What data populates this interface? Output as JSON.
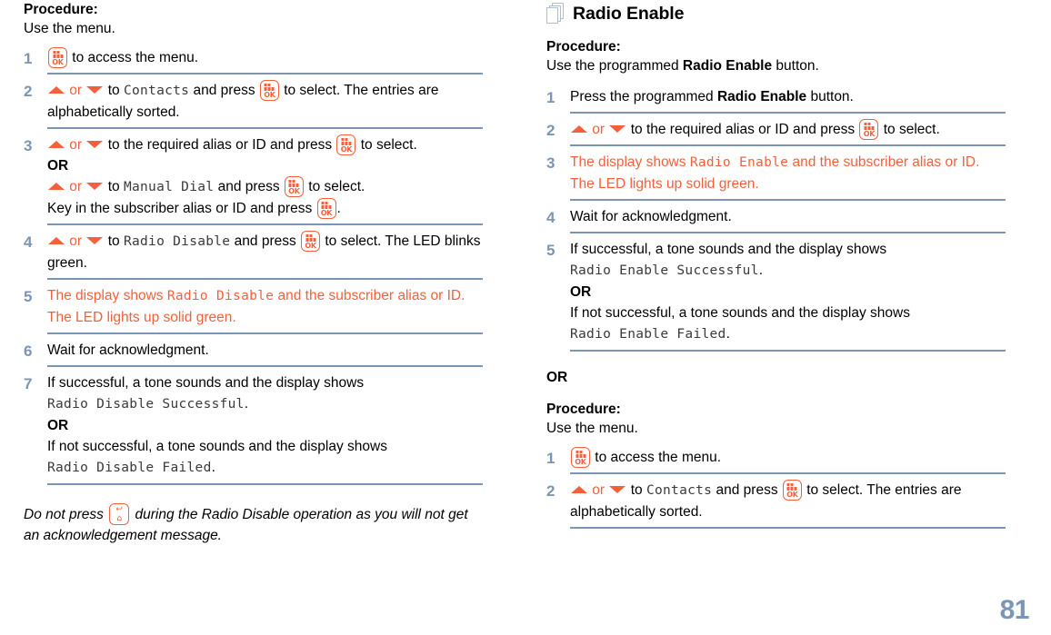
{
  "page": {
    "number": "81",
    "accent_orange": "#f4603c",
    "rule_blue": "#7b95b4",
    "number_color": "#7b95b4"
  },
  "left_column": {
    "procedure_label": "Procedure:",
    "procedure_intro": "Use the menu.",
    "steps": [
      {
        "num": "1",
        "parts": [
          {
            "type": "icon",
            "name": "menu-ok-key-icon"
          },
          {
            "type": "text",
            "value": " to access the menu."
          }
        ]
      },
      {
        "num": "2",
        "parts": [
          {
            "type": "icon",
            "name": "arrow-up-icon"
          },
          {
            "type": "orange",
            "value": " or "
          },
          {
            "type": "icon",
            "name": "arrow-down-icon"
          },
          {
            "type": "text",
            "value": " to "
          },
          {
            "type": "lcd",
            "value": "Contacts"
          },
          {
            "type": "text",
            "value": " and press "
          },
          {
            "type": "icon",
            "name": "menu-ok-key-icon"
          },
          {
            "type": "text",
            "value": " to select. The entries are alphabetically sorted."
          }
        ]
      },
      {
        "num": "3",
        "parts": [
          {
            "type": "icon",
            "name": "arrow-up-icon"
          },
          {
            "type": "orange",
            "value": " or "
          },
          {
            "type": "icon",
            "name": "arrow-down-icon"
          },
          {
            "type": "text",
            "value": " to the required alias or ID and press "
          },
          {
            "type": "icon",
            "name": "menu-ok-key-icon"
          },
          {
            "type": "text",
            "value": " to select."
          },
          {
            "type": "br"
          },
          {
            "type": "bold",
            "value": "OR"
          },
          {
            "type": "br"
          },
          {
            "type": "icon",
            "name": "arrow-up-icon"
          },
          {
            "type": "orange",
            "value": " or "
          },
          {
            "type": "icon",
            "name": "arrow-down-icon"
          },
          {
            "type": "text",
            "value": " to "
          },
          {
            "type": "lcd",
            "value": "Manual Dial"
          },
          {
            "type": "text",
            "value": " and press "
          },
          {
            "type": "icon",
            "name": "menu-ok-key-icon"
          },
          {
            "type": "text",
            "value": " to select."
          },
          {
            "type": "br"
          },
          {
            "type": "text",
            "value": "Key in the subscriber alias or ID and press "
          },
          {
            "type": "icon",
            "name": "menu-ok-key-icon"
          },
          {
            "type": "text",
            "value": "."
          }
        ]
      },
      {
        "num": "4",
        "parts": [
          {
            "type": "icon",
            "name": "arrow-up-icon"
          },
          {
            "type": "orange",
            "value": " or "
          },
          {
            "type": "icon",
            "name": "arrow-down-icon"
          },
          {
            "type": "text",
            "value": " to "
          },
          {
            "type": "lcd",
            "value": "Radio Disable"
          },
          {
            "type": "text",
            "value": " and press "
          },
          {
            "type": "icon",
            "name": "menu-ok-key-icon"
          },
          {
            "type": "text",
            "value": " to select. The LED blinks green."
          }
        ]
      },
      {
        "num": "5",
        "highlight": true,
        "parts": [
          {
            "type": "text",
            "value": " The display shows "
          },
          {
            "type": "lcd",
            "value": "Radio Disable"
          },
          {
            "type": "text",
            "value": " and the subscriber alias or ID. The LED lights up solid green."
          }
        ]
      },
      {
        "num": "6",
        "parts": [
          {
            "type": "text",
            "value": "Wait for acknowledgment."
          }
        ]
      },
      {
        "num": "7",
        "parts": [
          {
            "type": "text",
            "value": "If successful, a tone sounds and the display shows "
          },
          {
            "type": "lcd",
            "value": "Radio Disable Successful"
          },
          {
            "type": "text",
            "value": "."
          },
          {
            "type": "br"
          },
          {
            "type": "bold",
            "value": "OR"
          },
          {
            "type": "br"
          },
          {
            "type": "text",
            "value": "If not successful, a tone sounds and the display shows "
          },
          {
            "type": "lcd",
            "value": "Radio Disable Failed"
          },
          {
            "type": "text",
            "value": "."
          }
        ]
      }
    ],
    "note": {
      "before": "Do not press ",
      "icon": "back-home-key-icon",
      "after": " during the Radio Disable operation as you will not get an acknowledgement message."
    }
  },
  "right_column": {
    "heading": "Radio Enable",
    "heading_icon": "pages-stack-icon",
    "procedure_label_1": "Procedure:",
    "procedure_intro_1_before": "Use the programmed ",
    "procedure_intro_1_bold": "Radio Enable",
    "procedure_intro_1_after": " button.",
    "steps_1": [
      {
        "num": "1",
        "parts": [
          {
            "type": "text",
            "value": "Press the programmed "
          },
          {
            "type": "bold",
            "value": "Radio Enable"
          },
          {
            "type": "text",
            "value": " button."
          }
        ]
      },
      {
        "num": "2",
        "parts": [
          {
            "type": "icon",
            "name": "arrow-up-icon"
          },
          {
            "type": "orange",
            "value": " or "
          },
          {
            "type": "icon",
            "name": "arrow-down-icon"
          },
          {
            "type": "text",
            "value": " to the required alias or ID and press "
          },
          {
            "type": "icon",
            "name": "menu-ok-key-icon"
          },
          {
            "type": "text",
            "value": " to select."
          }
        ]
      },
      {
        "num": "3",
        "highlight": true,
        "parts": [
          {
            "type": "text",
            "value": " The display shows "
          },
          {
            "type": "lcd",
            "value": "Radio Enable"
          },
          {
            "type": "text",
            "value": " and the subscriber alias or ID. The LED lights up solid green."
          }
        ]
      },
      {
        "num": "4",
        "parts": [
          {
            "type": "text",
            "value": "Wait for acknowledgment."
          }
        ]
      },
      {
        "num": "5",
        "parts": [
          {
            "type": "text",
            "value": "If successful, a tone sounds and the display shows "
          },
          {
            "type": "lcd",
            "value": "Radio Enable Successful"
          },
          {
            "type": "text",
            "value": "."
          },
          {
            "type": "br"
          },
          {
            "type": "bold",
            "value": "OR"
          },
          {
            "type": "br"
          },
          {
            "type": "text",
            "value": "If not successful, a tone sounds and the display shows "
          },
          {
            "type": "lcd",
            "value": "Radio Enable Failed"
          },
          {
            "type": "text",
            "value": "."
          }
        ]
      }
    ],
    "or_divider": "OR",
    "procedure_label_2": "Procedure:",
    "procedure_intro_2": "Use the menu.",
    "steps_2": [
      {
        "num": "1",
        "parts": [
          {
            "type": "icon",
            "name": "menu-ok-key-icon"
          },
          {
            "type": "text",
            "value": " to access the menu."
          }
        ]
      },
      {
        "num": "2",
        "parts": [
          {
            "type": "icon",
            "name": "arrow-up-icon"
          },
          {
            "type": "orange",
            "value": " or "
          },
          {
            "type": "icon",
            "name": "arrow-down-icon"
          },
          {
            "type": "text",
            "value": " to "
          },
          {
            "type": "lcd",
            "value": "Contacts"
          },
          {
            "type": "text",
            "value": " and press "
          },
          {
            "type": "icon",
            "name": "menu-ok-key-icon"
          },
          {
            "type": "text",
            "value": " to select. The entries are alphabetically sorted."
          }
        ]
      }
    ]
  }
}
